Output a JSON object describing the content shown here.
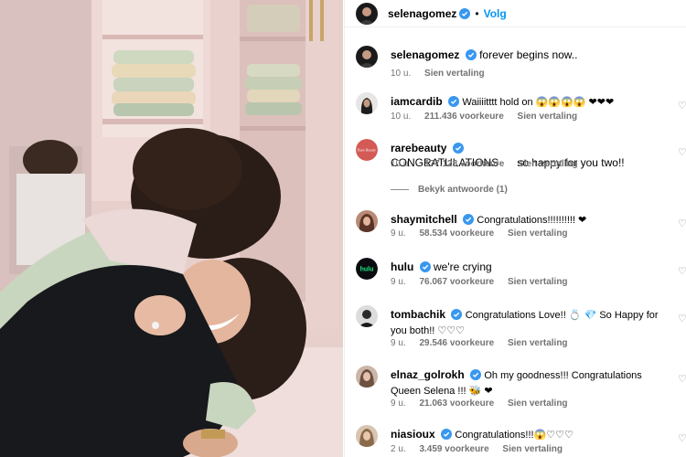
{
  "post": {
    "username": "selenagomez",
    "follow_label": "Volg",
    "caption": "forever begins now..",
    "caption_time": "10 u.",
    "caption_translate": "Sien vertaling"
  },
  "comments": [
    {
      "username": "iamcardib",
      "text": "Waiiiitttt hold on 😱😱😱😱 ❤❤❤",
      "time": "10 u.",
      "likes": "211.436 voorkeure",
      "translate": "Sien vertaling"
    },
    {
      "username": "rarebeauty",
      "text": "CONGRATULATIONS      so happy for you two!!",
      "time": "10 u.",
      "likes": "177.128 voorkeure",
      "translate": "Sien vertaling",
      "replies_label": "Bekyk antwoorde (1)"
    },
    {
      "username": "shaymitchell",
      "text": "Congratulations!!!!!!!!!! ❤",
      "time": "9 u.",
      "likes": "58.534 voorkeure",
      "translate": "Sien vertaling"
    },
    {
      "username": "hulu",
      "text": "we're crying",
      "time": "9 u.",
      "likes": "76.067 voorkeure",
      "translate": "Sien vertaling"
    },
    {
      "username": "tombachik",
      "text": "Congratulations Love!! 💍 💎 So Happy for you both!! ♡♡♡",
      "time": "9 u.",
      "likes": "29.546 voorkeure",
      "translate": "Sien vertaling"
    },
    {
      "username": "elnaz_golrokh",
      "text": "Oh my goodness!!! Congratulations Queen Selena !!! 🐝 ❤",
      "time": "9 u.",
      "likes": "21.063 voorkeure",
      "translate": "Sien vertaling"
    },
    {
      "username": "niasioux",
      "text": "Congratulations!!!😱♡♡♡",
      "time": "2 u.",
      "likes": "3.459 voorkeure",
      "translate": "Sien vertaling"
    }
  ],
  "hulu_logo_text": "hulu",
  "rarebeauty_logo_text": "Rare Beauty",
  "colors": {
    "link": "#0095f6",
    "verified": "#3897f0",
    "meta": "#737373",
    "hulu": "#1ce783"
  },
  "icons": {
    "verified": "verified-badge-icon",
    "like": "heart-outline-icon"
  }
}
